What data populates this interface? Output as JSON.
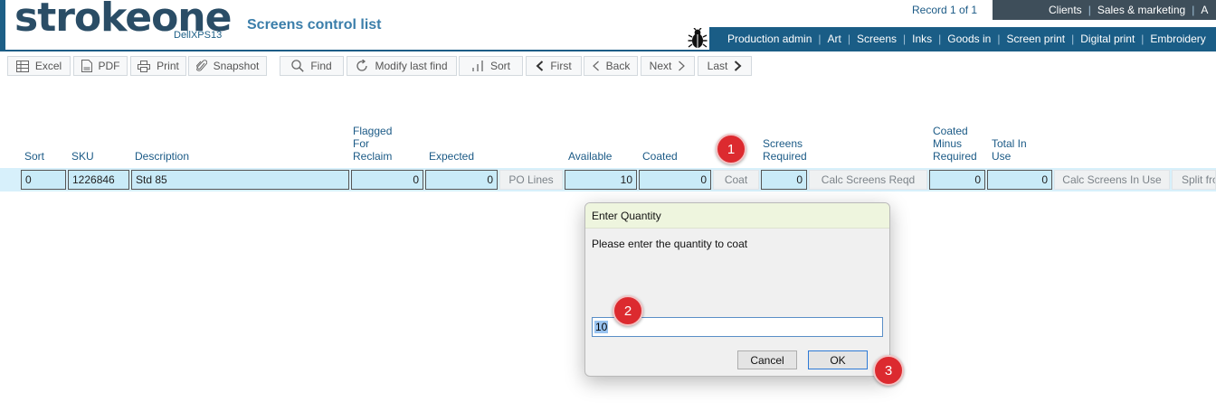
{
  "header": {
    "logo_text": "strokeone",
    "logo_subtitle": "DellXPS13",
    "page_title": "Screens control list",
    "record_count": "Record 1 of 1"
  },
  "nav_top": [
    "Clients",
    "Sales & marketing",
    "A"
  ],
  "nav_bottom": [
    "Production admin",
    "Art",
    "Screens",
    "Inks",
    "Goods in",
    "Screen print",
    "Digital print",
    "Embroidery"
  ],
  "toolbar": {
    "excel": "Excel",
    "pdf": "PDF",
    "print": "Print",
    "snapshot": "Snapshot",
    "find": "Find",
    "modify_last_find": "Modify last find",
    "sort": "Sort",
    "first": "First",
    "back": "Back",
    "next": "Next",
    "last": "Last"
  },
  "columns": {
    "sort": "Sort",
    "sku": "SKU",
    "description": "Description",
    "flagged": [
      "Flagged",
      "For",
      "Reclaim"
    ],
    "expected": "Expected",
    "available": "Available",
    "coated": "Coated",
    "screens_required": [
      "Screens",
      "Required"
    ],
    "coated_minus_required": [
      "Coated",
      "Minus",
      "Required"
    ],
    "total_in_use": [
      "Total In",
      "Use"
    ]
  },
  "row": {
    "sort": "0",
    "sku": "1226846",
    "description": "Std 85",
    "flagged_for_reclaim": "0",
    "expected": "0",
    "po_lines_button": "PO Lines",
    "available": "10",
    "coated": "0",
    "coat_button": "Coat",
    "screens_required": "0",
    "calc_screens_reqd_button": "Calc Screens Reqd",
    "coated_minus_required": "0",
    "total_in_use": "0",
    "calc_screens_in_use_button": "Calc Screens In Use",
    "split_button": "Split fro"
  },
  "dialog": {
    "title": "Enter Quantity",
    "message": "Please enter the quantity to coat",
    "input_value": "10",
    "cancel": "Cancel",
    "ok": "OK"
  },
  "steps": [
    "1",
    "2",
    "3"
  ],
  "colors": {
    "brand_dark": "#2a4d66",
    "brand_blue": "#1a5d86",
    "row_highlight": "#c9ebf8",
    "dialog_title_bg": "#eef5de",
    "step_marker": "#dc2a2f"
  }
}
